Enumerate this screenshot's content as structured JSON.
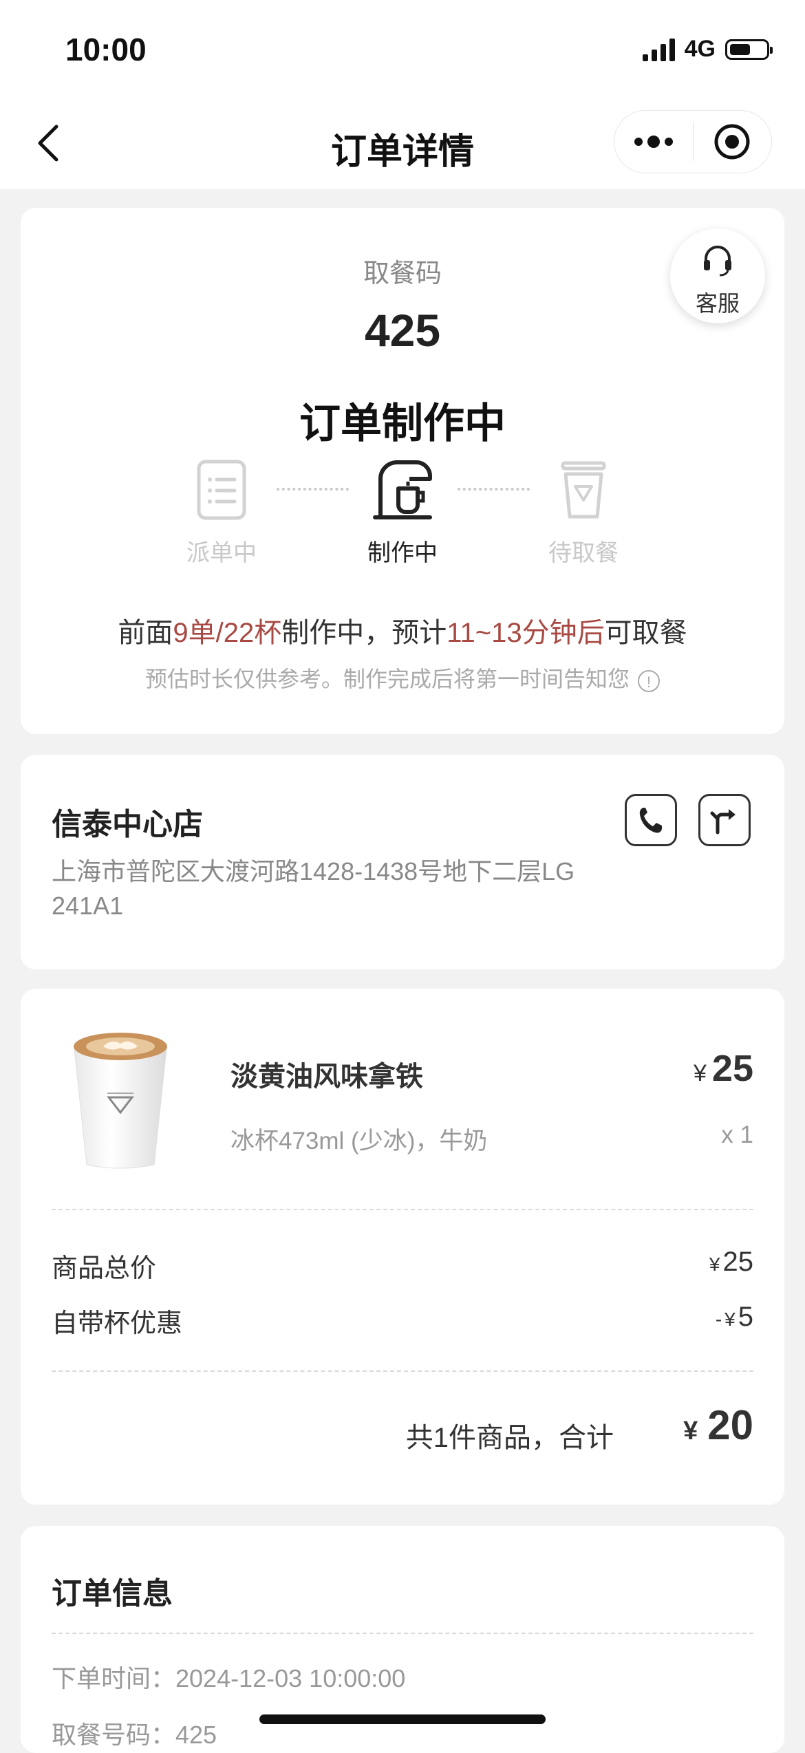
{
  "status_bar": {
    "time": "10:00",
    "network": "4G"
  },
  "nav": {
    "title": "订单详情"
  },
  "order_card": {
    "pickup_label": "取餐码",
    "pickup_code": "425",
    "customer_service": "客服",
    "status": "订单制作中",
    "steps": [
      {
        "label": "派单中",
        "active": false,
        "icon": "receipt-icon"
      },
      {
        "label": "制作中",
        "active": true,
        "icon": "coffee-machine-icon"
      },
      {
        "label": "待取餐",
        "active": false,
        "icon": "cup-icon"
      }
    ],
    "wait": {
      "prefix": "前面",
      "queue": "9单/22杯",
      "mid": "制作中，预计",
      "eta": "11~13分钟后",
      "suffix": "可取餐"
    },
    "note": "预估时长仅供参考。制作完成后将第一时间告知您",
    "highlight_color": "#a84a43"
  },
  "store": {
    "name": "信泰中心店",
    "address": "上海市普陀区大渡河路1428-1438号地下二层LG 241A1"
  },
  "product": {
    "name": "淡黄油风味拿铁",
    "options": "冰杯473ml (少冰)，牛奶",
    "currency": "¥",
    "price": "25",
    "qty": "x 1"
  },
  "summary": {
    "subtotal_label": "商品总价",
    "subtotal": "25",
    "discount_label": "自带杯优惠",
    "discount_prefix": "-",
    "discount": "5",
    "total_label": "共1件商品，合计",
    "total": "20"
  },
  "order_info": {
    "title": "订单信息",
    "time_label": "下单时间：",
    "time": "2024-12-03 10:00:00",
    "code_label": "取餐号码：",
    "code": "425"
  }
}
